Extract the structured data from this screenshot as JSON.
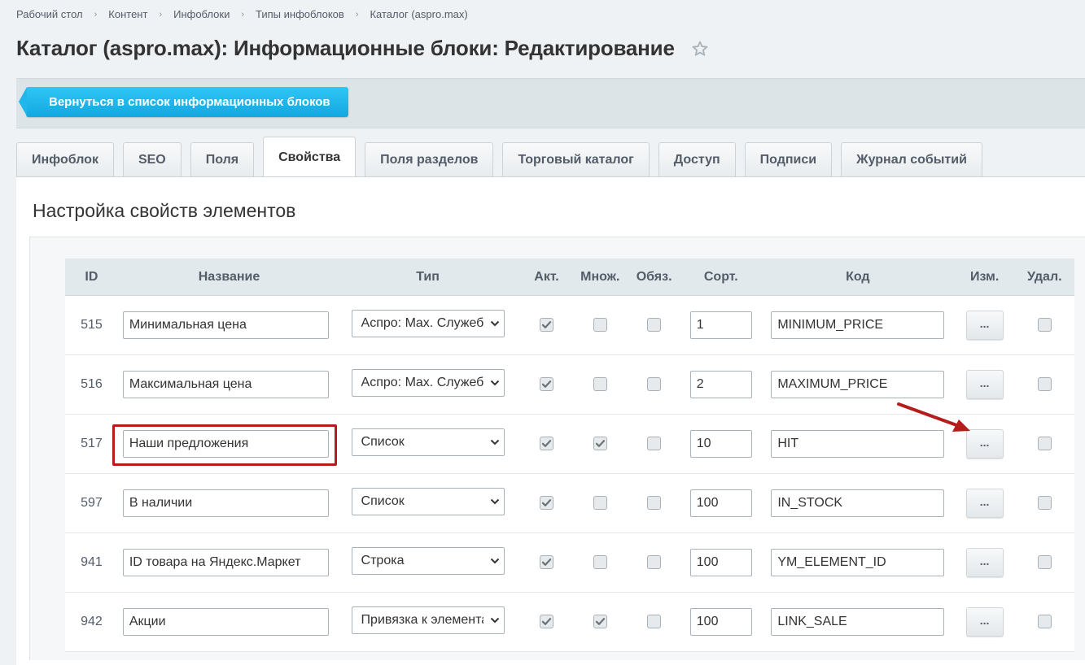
{
  "breadcrumb": [
    "Рабочий стол",
    "Контент",
    "Инфоблоки",
    "Типы инфоблоков",
    "Каталог (aspro.max)"
  ],
  "page_title": "Каталог (aspro.max): Информационные блоки: Редактирование",
  "back_button": "Вернуться в список информационных блоков",
  "tabs": [
    {
      "label": "Инфоблок",
      "active": false
    },
    {
      "label": "SEO",
      "active": false
    },
    {
      "label": "Поля",
      "active": false
    },
    {
      "label": "Свойства",
      "active": true
    },
    {
      "label": "Поля разделов",
      "active": false
    },
    {
      "label": "Торговый каталог",
      "active": false
    },
    {
      "label": "Доступ",
      "active": false
    },
    {
      "label": "Подписи",
      "active": false
    },
    {
      "label": "Журнал событий",
      "active": false
    }
  ],
  "section_title": "Настройка свойств элементов",
  "table": {
    "headers": {
      "id": "ID",
      "name": "Название",
      "type": "Тип",
      "active": "Акт.",
      "multiple": "Множ.",
      "required": "Обяз.",
      "sort": "Сорт.",
      "code": "Код",
      "edit": "Изм.",
      "delete": "Удал."
    },
    "edit_label": "...",
    "rows": [
      {
        "id": "515",
        "name": "Минимальная цена",
        "type": "Аспро: Max. Служебное",
        "active": true,
        "multiple": false,
        "required": false,
        "sort": "1",
        "code": "MINIMUM_PRICE",
        "delete": false
      },
      {
        "id": "516",
        "name": "Максимальная цена",
        "type": "Аспро: Max. Служебное",
        "active": true,
        "multiple": false,
        "required": false,
        "sort": "2",
        "code": "MAXIMUM_PRICE",
        "delete": false
      },
      {
        "id": "517",
        "name": "Наши предложения",
        "type": "Список",
        "active": true,
        "multiple": true,
        "required": false,
        "sort": "10",
        "code": "HIT",
        "delete": false
      },
      {
        "id": "597",
        "name": "В наличии",
        "type": "Список",
        "active": true,
        "multiple": false,
        "required": false,
        "sort": "100",
        "code": "IN_STOCK",
        "delete": false
      },
      {
        "id": "941",
        "name": "ID товара на Яндекс.Маркет",
        "type": "Строка",
        "active": true,
        "multiple": false,
        "required": false,
        "sort": "100",
        "code": "YM_ELEMENT_ID",
        "delete": false
      },
      {
        "id": "942",
        "name": "Акции",
        "type": "Привязка к элементам",
        "active": true,
        "multiple": true,
        "required": false,
        "sort": "100",
        "code": "LINK_SALE",
        "delete": false
      }
    ]
  },
  "annotation_color": "#b51d1d"
}
